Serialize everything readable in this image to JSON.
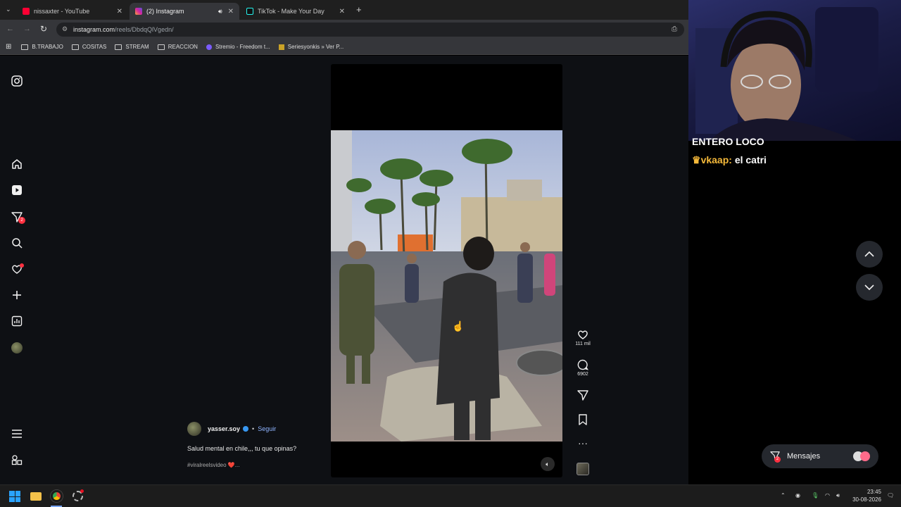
{
  "browser": {
    "tabs": [
      {
        "title": "nissaxter - YouTube",
        "active": false
      },
      {
        "title": "(2) Instagram",
        "active": true
      },
      {
        "title": "TikTok - Make Your Day",
        "active": false
      }
    ],
    "url_host": "instagram.com",
    "url_path": "/reels/DbdqQlVgedn/",
    "bookmarks": [
      "B.TRABAJO",
      "COSITAS",
      "STREAM",
      "REACCION",
      "Stremio - Freedom t...",
      "Seriesyonkis » Ver P..."
    ]
  },
  "instagram": {
    "nav": [
      "instagram-logo",
      "home",
      "reels",
      "messages",
      "search",
      "notifications",
      "create",
      "dashboard",
      "profile",
      "more",
      "also-from-meta"
    ],
    "messages_badge": "2",
    "reel": {
      "username": "yasser.soy",
      "follow": "Seguir",
      "caption": "Salud mental en chile,,, tu que opinas?",
      "hashtags": "#viralreelsvideo ❤️...",
      "likes": "111 mil",
      "comments": "6902"
    },
    "messages_pill": {
      "label": "Mensajes",
      "badge": "2"
    }
  },
  "stream_overlay": {
    "chat_line_1": "ENTERO LOCO",
    "chat_user": "vkaap:",
    "chat_msg": "el catri",
    "chat_user_color": "#f5b93a"
  },
  "taskbar": {
    "time": "23:45",
    "date": "30-08-2026"
  }
}
